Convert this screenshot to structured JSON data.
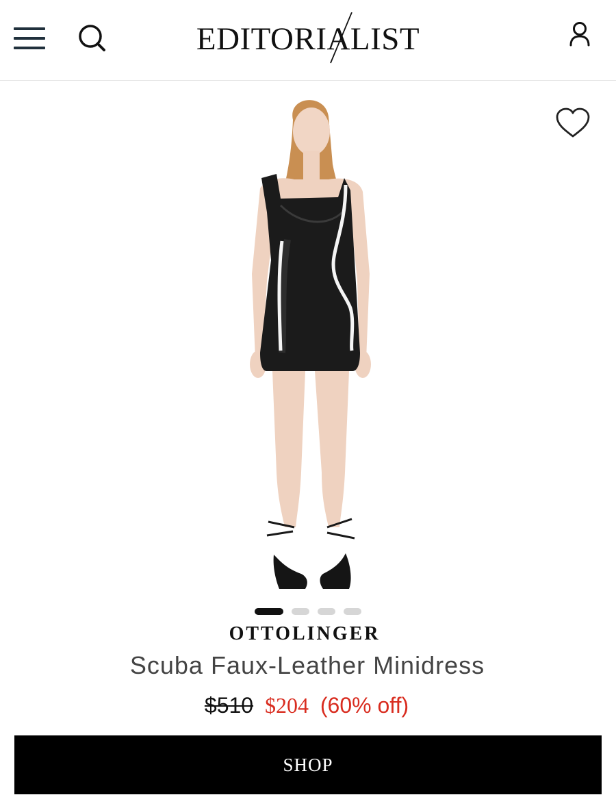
{
  "header": {
    "menu_icon": "hamburger-menu-icon",
    "search_icon": "search-icon",
    "logo_text": "EDITORIALIST",
    "account_icon": "user-icon"
  },
  "product": {
    "image_alt": "model wearing black faux-leather minidress with white piping and black lace-up sandals",
    "wishlist_icon": "heart-icon",
    "carousel": {
      "count": 4,
      "active_index": 0
    },
    "brand": "OTTOLINGER",
    "name": "Scuba Faux-Leather Minidress",
    "price_original": "$510",
    "price_sale": "$204",
    "discount": "(60% off)"
  },
  "actions": {
    "shop_label": "SHOP"
  },
  "colors": {
    "sale_red": "#d92d20",
    "nav_icon": "#20303c",
    "button_bg": "#000000",
    "dot_active": "#111111",
    "dot_inactive": "#d6d6d6"
  }
}
